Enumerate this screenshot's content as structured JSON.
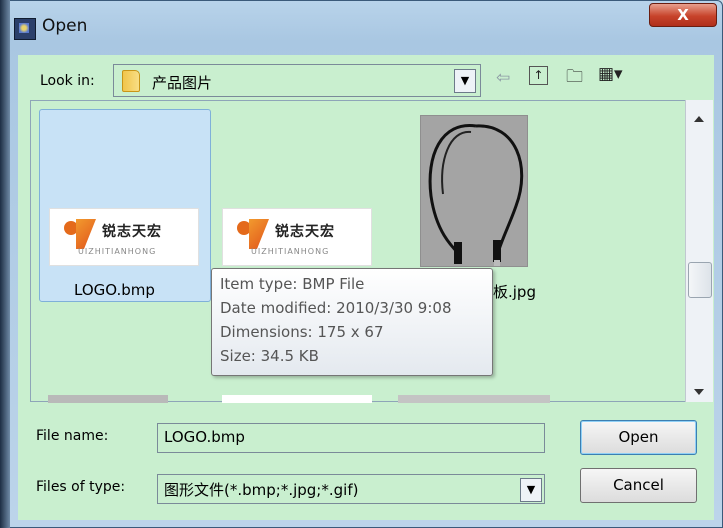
{
  "window": {
    "title": "Open",
    "close_label": "X"
  },
  "toolbar": {
    "look_in_label": "Look in:",
    "look_in_value": "产品图片",
    "back_icon": "back-arrow-icon",
    "up_icon": "up-one-level-icon",
    "new_folder_icon": "new-folder-icon",
    "view_menu_icon": "view-menu-icon"
  },
  "files": [
    {
      "name": "LOGO.bmp",
      "selected": true,
      "thumb_cn": "锐志天宏",
      "thumb_en": "UIZHITIANHONG"
    },
    {
      "name": "",
      "selected": false,
      "thumb_cn": "锐志天宏",
      "thumb_en": "UIZHITIANHONG"
    },
    {
      "name": "板.jpg",
      "selected": false
    }
  ],
  "tooltip": {
    "item_type": "Item type: BMP File",
    "date_modified": "Date modified: 2010/3/30 9:08",
    "dimensions": "Dimensions: 175 x 67",
    "size": "Size: 34.5 KB"
  },
  "form": {
    "file_name_label": "File name:",
    "file_name_value": "LOGO.bmp",
    "files_of_type_label": "Files of type:",
    "files_of_type_value": "图形文件(*.bmp;*.jpg;*.gif)",
    "open_label": "Open",
    "cancel_label": "Cancel"
  },
  "colors": {
    "panel_bg": "#c9efcf",
    "close_red": "#c7432b",
    "selection": "#c8e2f6"
  }
}
